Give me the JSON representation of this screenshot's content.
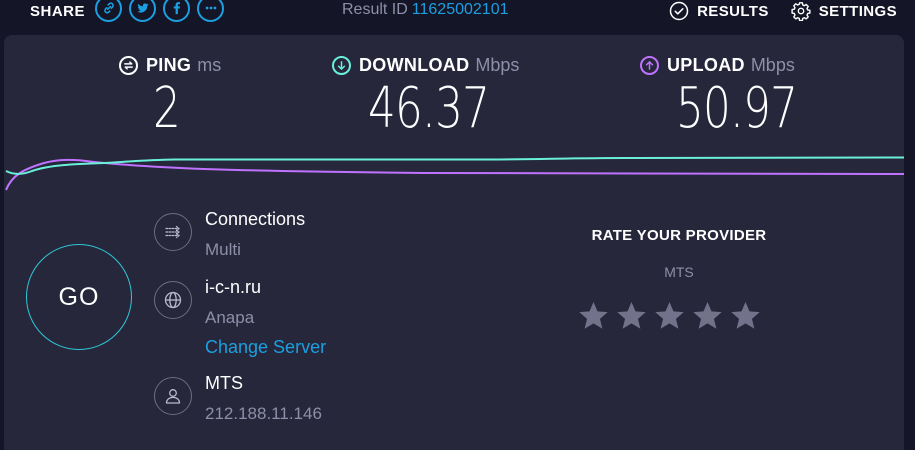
{
  "share": {
    "label": "SHARE"
  },
  "result": {
    "label": "Result ID",
    "id": "11625002101"
  },
  "nav": {
    "results_label": "RESULTS",
    "settings_label": "SETTINGS"
  },
  "metrics": {
    "ping": {
      "title": "PING",
      "unit": "ms",
      "value": "2"
    },
    "download": {
      "title": "DOWNLOAD",
      "unit": "Mbps",
      "value": "46.37",
      "color": "#6af0d9"
    },
    "upload": {
      "title": "UPLOAD",
      "unit": "Mbps",
      "value": "50.97",
      "color": "#bf72ff"
    }
  },
  "go": {
    "label": "GO"
  },
  "connections": {
    "title": "Connections",
    "value": "Multi"
  },
  "server": {
    "name": "i-c-n.ru",
    "location": "Anapa",
    "change_label": "Change Server"
  },
  "isp": {
    "name": "MTS",
    "ip": "212.188.11.146"
  },
  "rate": {
    "title": "RATE YOUR PROVIDER",
    "provider": "MTS",
    "stars_total": 5,
    "stars_selected": 0
  },
  "colors": {
    "accent": "#1c9fe0",
    "background": "#141526",
    "panel": "#26273b",
    "go_ring": "#2fc8d6"
  }
}
